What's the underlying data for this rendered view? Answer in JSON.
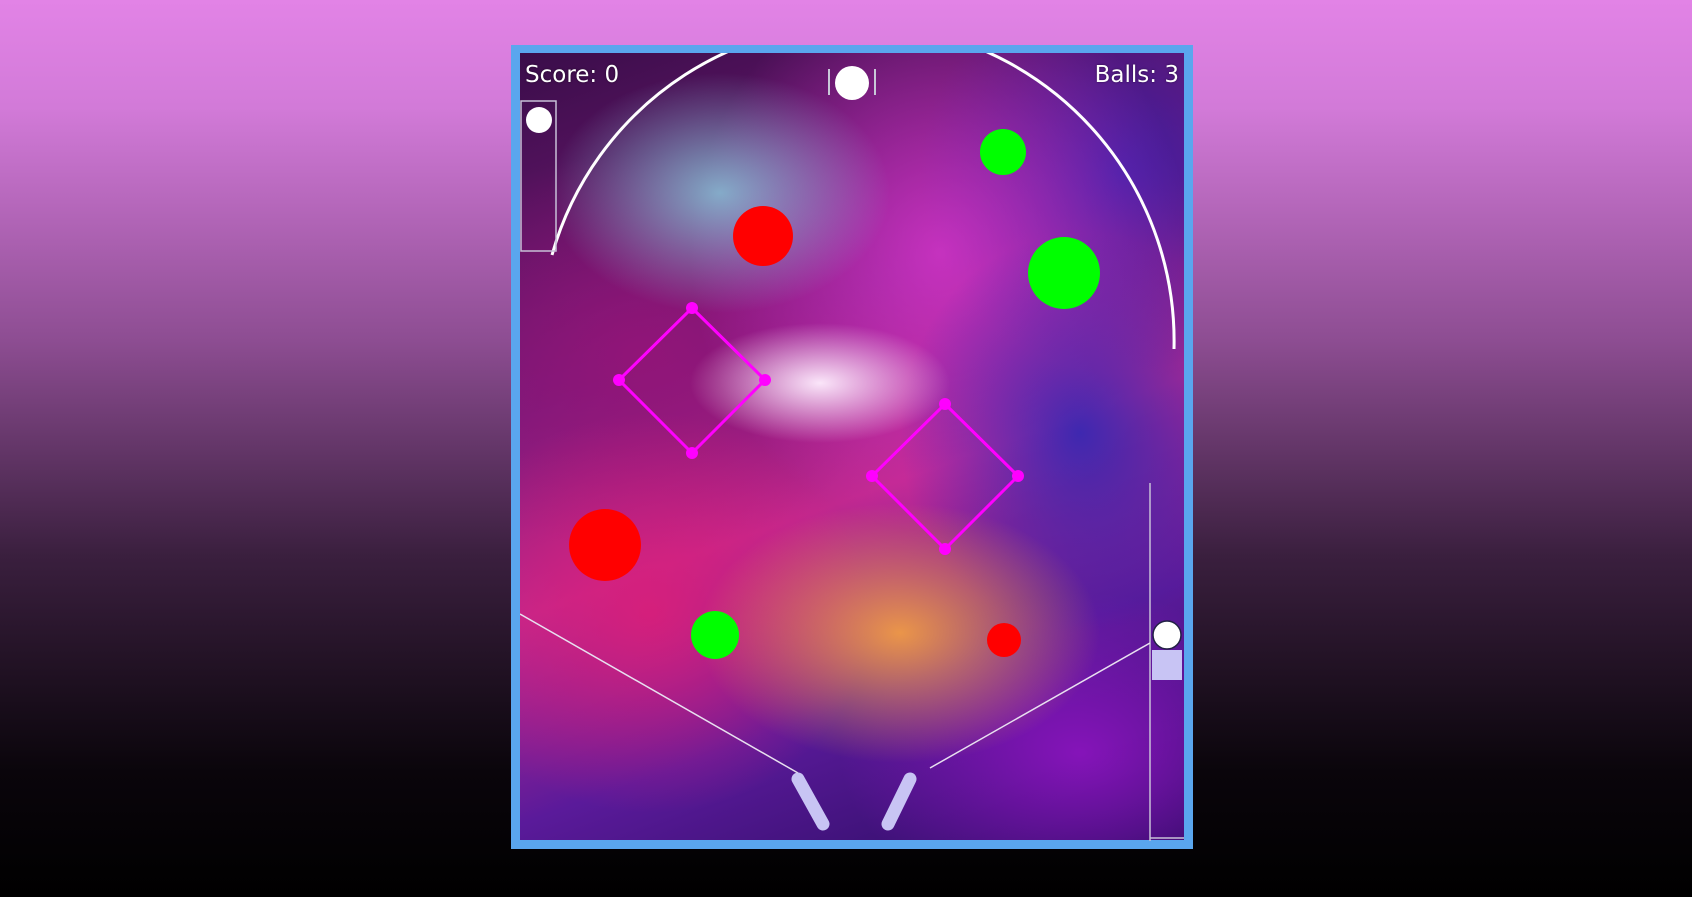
{
  "hud": {
    "score_label": "Score: 0",
    "balls_label": "Balls: 3",
    "score": 0,
    "balls": 3
  },
  "colors": {
    "frame_border": "#5aa6ee",
    "bumper_red": "#ff0000",
    "bumper_green": "#00ff00",
    "diamond_magenta": "#ff00ff",
    "flipper": "#c8c4f4",
    "plunger": "#c8c4f4",
    "ball": "#ffffff",
    "rail": "#ffffff"
  },
  "icons": {
    "ball": "white-circle",
    "bumper": "filled-circle",
    "diamond_target": "magenta-diamond-with-dot-corners",
    "flipper": "rounded-bar"
  }
}
